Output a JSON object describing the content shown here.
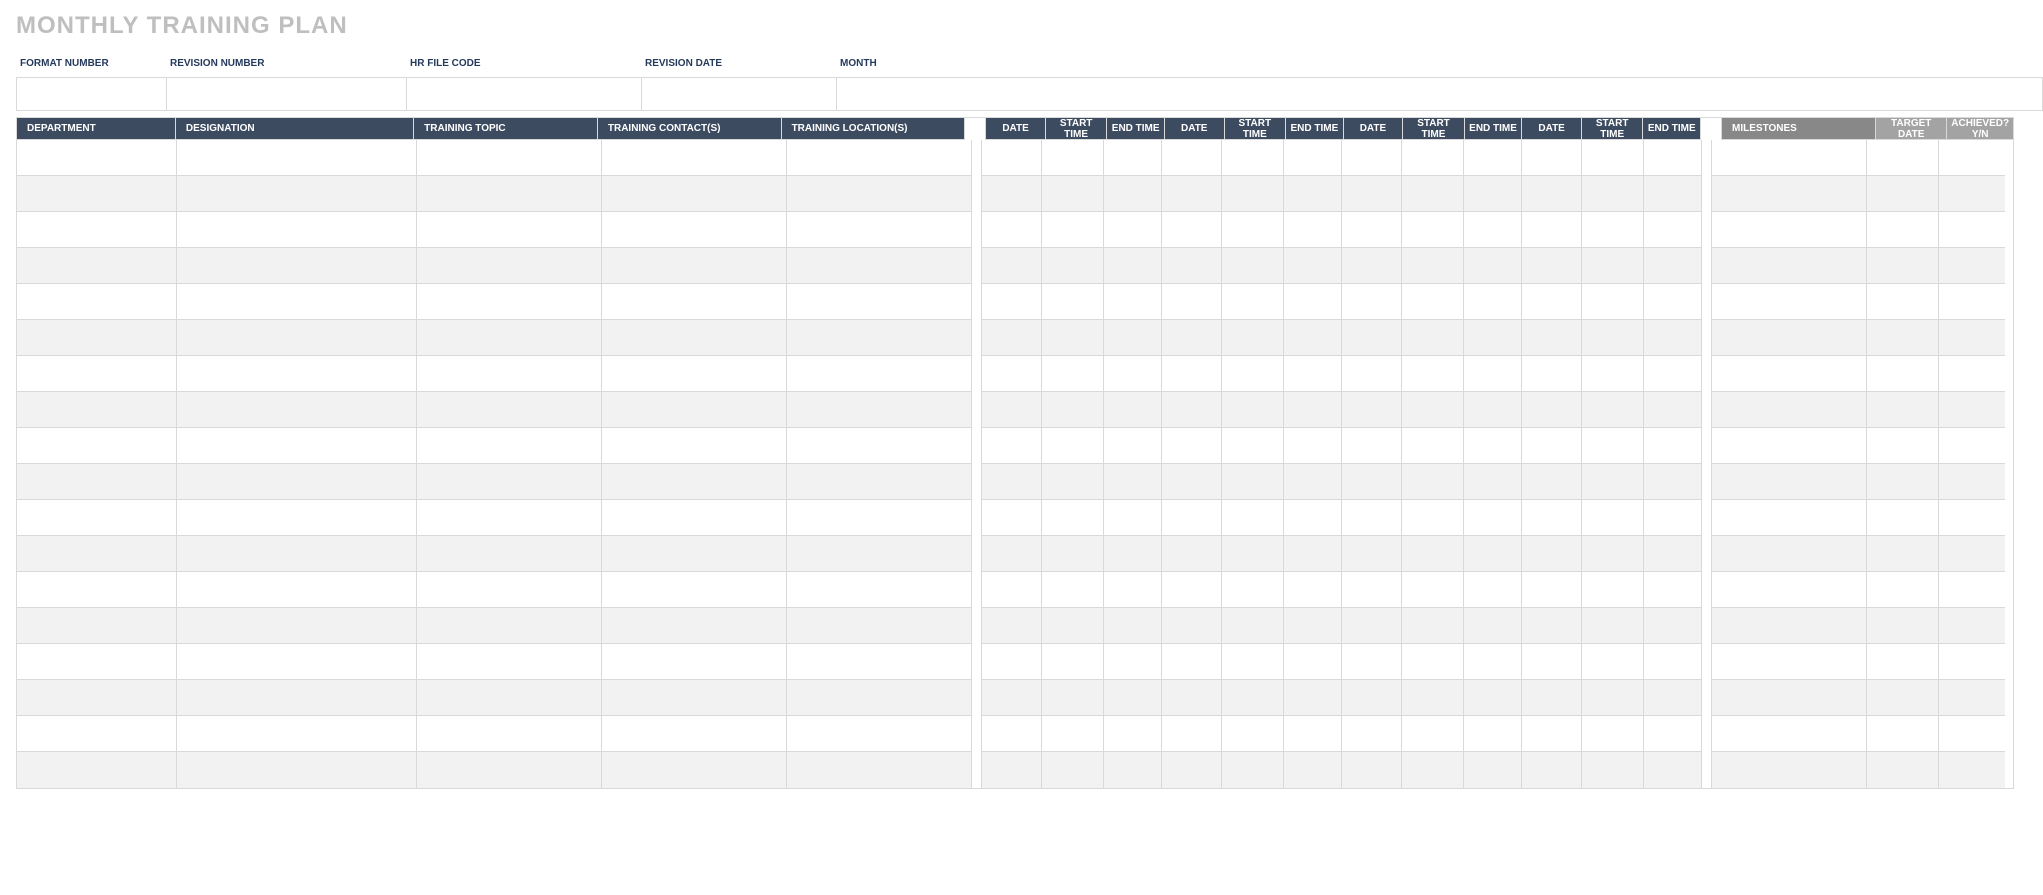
{
  "title": "MONTHLY TRAINING PLAN",
  "meta": {
    "labels": {
      "format_number": "FORMAT NUMBER",
      "revision_number": "REVISION NUMBER",
      "hr_file_code": "HR FILE CODE",
      "revision_date": "REVISION DATE",
      "month": "MONTH"
    },
    "values": {
      "format_number": "",
      "revision_number": "",
      "hr_file_code": "",
      "revision_date": "",
      "month": ""
    }
  },
  "table": {
    "headers": {
      "department": "DEPARTMENT",
      "designation": "DESIGNATION",
      "training_topic": "TRAINING TOPIC",
      "training_contacts": "TRAINING CONTACT(S)",
      "training_locations": "TRAINING LOCATION(S)",
      "date": "DATE",
      "start_time": "START TIME",
      "end_time": "END TIME",
      "milestones": "MILESTONES",
      "target_date": "TARGET DATE",
      "achieved": "ACHIEVED? Y/N"
    },
    "rows": [
      {},
      {},
      {},
      {},
      {},
      {},
      {},
      {},
      {},
      {},
      {},
      {},
      {},
      {},
      {},
      {},
      {},
      {}
    ]
  },
  "colors": {
    "navy_header": "#3d4b61",
    "gray_header": "#888888",
    "gray_header_light": "#a3a3a3",
    "row_alt": "#f2f2f2",
    "border": "#d9d9d9",
    "title_gray": "#bfbfbf",
    "label_navy": "#253a5b"
  }
}
